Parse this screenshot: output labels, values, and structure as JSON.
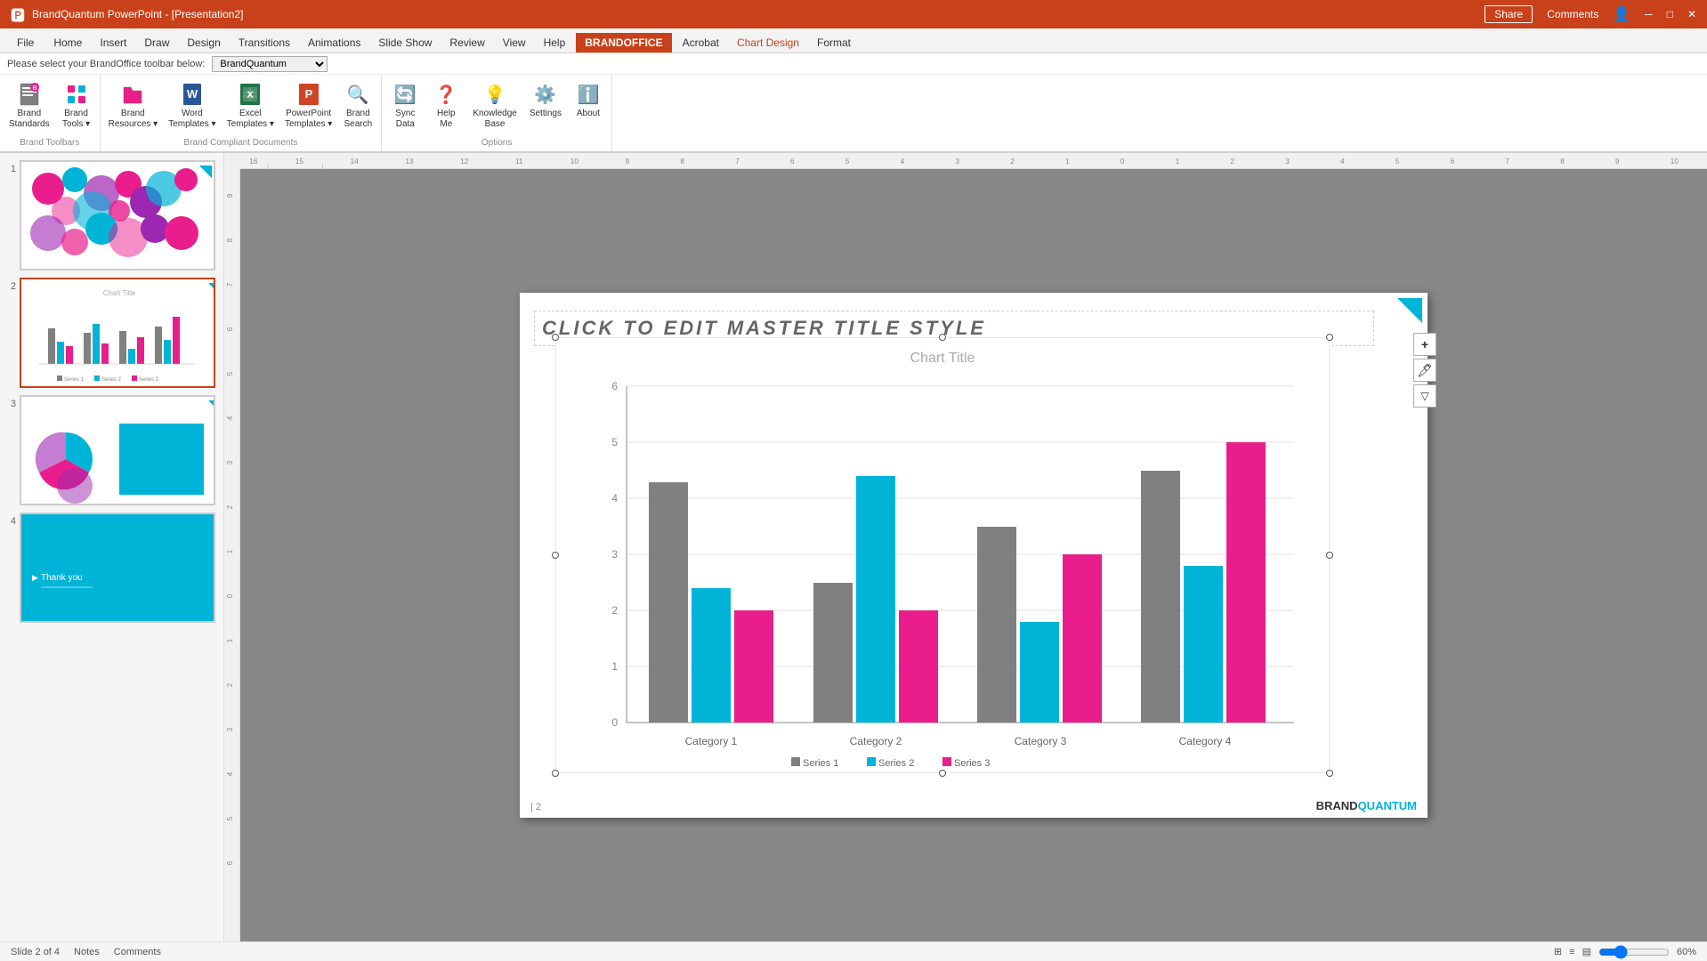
{
  "titlebar": {
    "title": "BrandQuantum PowerPoint - [Presentation2]",
    "share_label": "Share",
    "comments_label": "Comments",
    "user_icon": "👤"
  },
  "ribbon": {
    "tabs": [
      {
        "id": "file",
        "label": "File"
      },
      {
        "id": "home",
        "label": "Home"
      },
      {
        "id": "insert",
        "label": "Insert"
      },
      {
        "id": "draw",
        "label": "Draw"
      },
      {
        "id": "design",
        "label": "Design"
      },
      {
        "id": "transitions",
        "label": "Transitions"
      },
      {
        "id": "animations",
        "label": "Animations"
      },
      {
        "id": "slide-show",
        "label": "Slide Show"
      },
      {
        "id": "review",
        "label": "Review"
      },
      {
        "id": "view",
        "label": "View"
      },
      {
        "id": "help",
        "label": "Help"
      },
      {
        "id": "brandoffice",
        "label": "BRANDOFFICE",
        "active": true
      },
      {
        "id": "acrobat",
        "label": "Acrobat"
      },
      {
        "id": "chart-design",
        "label": "Chart Design"
      },
      {
        "id": "format",
        "label": "Format"
      }
    ],
    "toolbar_label": "Please select your BrandOffice toolbar below:",
    "toolbar_dropdown": "BrandQuantum",
    "sections": {
      "brand_toolbars_label": "Brand Toolbars",
      "brand_compliant_docs_label": "Brand Compliant Documents",
      "options_label": "Options"
    },
    "buttons": [
      {
        "id": "brand-standards",
        "label": "Brand\nStandards",
        "icon": "📋",
        "has_arrow": true
      },
      {
        "id": "brand-tools",
        "label": "Brand\nTools",
        "icon": "🔧",
        "has_arrow": true
      },
      {
        "id": "brand-resources",
        "label": "Brand\nResources",
        "icon": "📁",
        "has_arrow": true
      },
      {
        "id": "word-templates",
        "label": "Word\nTemplates",
        "icon": "📝",
        "has_arrow": true
      },
      {
        "id": "excel-templates",
        "label": "Excel\nTemplates",
        "icon": "📊",
        "has_arrow": true
      },
      {
        "id": "powerpoint-templates",
        "label": "PowerPoint\nTemplates",
        "icon": "📑",
        "has_arrow": true
      },
      {
        "id": "brand-search",
        "label": "Brand\nSearch",
        "icon": "🔍"
      },
      {
        "id": "sync-data",
        "label": "Sync\nData",
        "icon": "🔄"
      },
      {
        "id": "help-me",
        "label": "Help\nMe",
        "icon": "❓"
      },
      {
        "id": "knowledge-base",
        "label": "Knowledge\nBase",
        "icon": "💡"
      },
      {
        "id": "settings",
        "label": "Settings",
        "icon": "⚙️"
      },
      {
        "id": "about",
        "label": "About",
        "icon": "ℹ️"
      }
    ]
  },
  "slides": [
    {
      "num": 1,
      "type": "circles",
      "active": false
    },
    {
      "num": 2,
      "type": "chart",
      "active": true
    },
    {
      "num": 3,
      "type": "shapes",
      "active": false
    },
    {
      "num": 4,
      "type": "thankyou",
      "active": false,
      "text": "Thank you"
    }
  ],
  "chart": {
    "title": "Chart Title",
    "categories": [
      "Category 1",
      "Category 2",
      "Category 3",
      "Category 4"
    ],
    "series": [
      {
        "name": "Series 1",
        "color": "#808080",
        "values": [
          4.3,
          2.5,
          3.5,
          4.5
        ]
      },
      {
        "name": "Series 2",
        "color": "#00b4d8",
        "values": [
          2.4,
          4.4,
          1.8,
          2.8
        ]
      },
      {
        "name": "Series 3",
        "color": "#e91e8c",
        "values": [
          2.0,
          2.0,
          3.0,
          5.0
        ]
      }
    ],
    "y_max": 6,
    "y_labels": [
      "6",
      "5",
      "4",
      "3",
      "2",
      "1",
      "0"
    ]
  },
  "slide": {
    "title": "CLICK TO EDIT MASTER TITLE STYLE",
    "page_num": "2",
    "brand_name": "BRAND",
    "brand_accent": "QUANTUM",
    "footer_slide": "| 2"
  },
  "status": {
    "slide_info": "Slide 2 of 4",
    "notes": "Notes",
    "comments": "Comments",
    "zoom": "60%"
  }
}
